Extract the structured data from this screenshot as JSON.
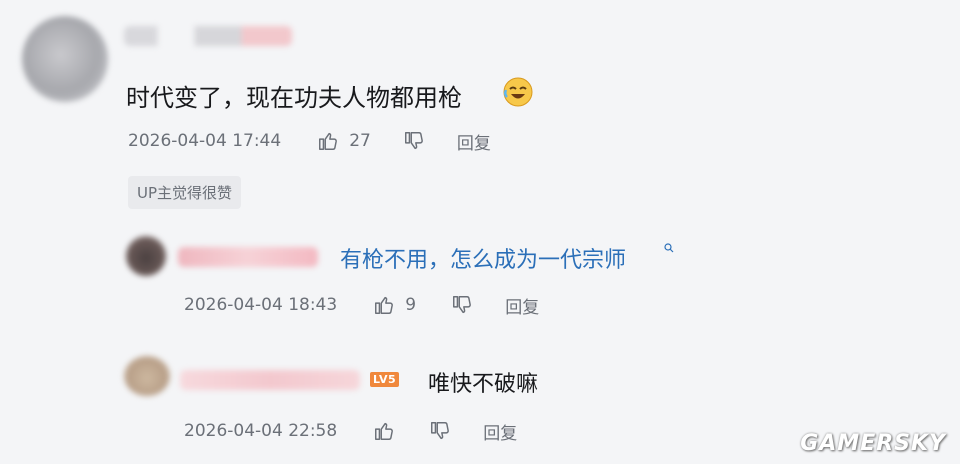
{
  "comments": [
    {
      "text": "时代变了，现在功夫人物都用枪",
      "emoji": "laugh-cry-emoji",
      "timestamp": "2026-04-04 17:44",
      "likes": "27",
      "reply_label": "回复",
      "badge": "UP主觉得很赞"
    },
    {
      "text": "有枪不用，怎么成为一代宗师",
      "timestamp": "2026-04-04 18:43",
      "likes": "9",
      "reply_label": "回复"
    },
    {
      "level_badge": "LV5",
      "text": "唯快不破嘛",
      "timestamp": "2026-04-04 22:58",
      "reply_label": "回复"
    }
  ],
  "watermark": "GAMERSKY",
  "colors": {
    "link": "#2b6fb8",
    "level_badge": "#f0883c",
    "meta": "#6b7078"
  }
}
